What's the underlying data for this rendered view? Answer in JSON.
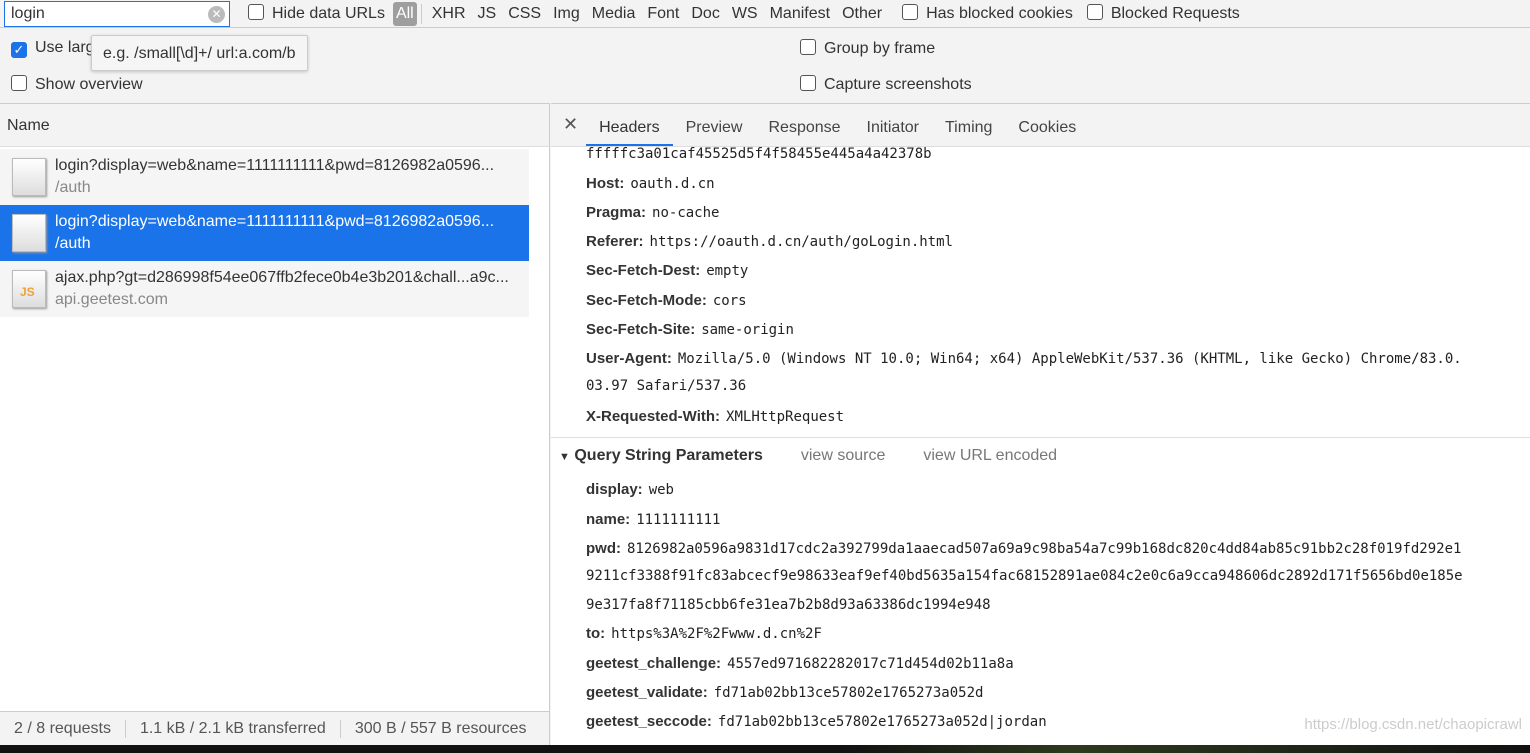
{
  "filter": {
    "search_value": "login",
    "hide_data_urls": "Hide data URLs",
    "types": [
      "All",
      "XHR",
      "JS",
      "CSS",
      "Img",
      "Media",
      "Font",
      "Doc",
      "WS",
      "Manifest",
      "Other"
    ],
    "has_blocked_cookies": "Has blocked cookies",
    "blocked_requests": "Blocked Requests"
  },
  "options": {
    "use_large": "Use larg",
    "show_overview": "Show overview",
    "group_by_frame": "Group by frame",
    "capture_screenshots": "Capture screenshots"
  },
  "tooltip": "e.g. /small[\\d]+/ url:a.com/b",
  "list": {
    "header": "Name",
    "rows": [
      {
        "name": "login?display=web&name=1111111111&pwd=8126982a0596...",
        "sub": "/auth",
        "type": "doc"
      },
      {
        "name": "login?display=web&name=1111111111&pwd=8126982a0596...",
        "sub": "/auth",
        "type": "doc",
        "selected": true
      },
      {
        "name": "ajax.php?gt=d286998f54ee067ffb2fece0b4e3b201&chall...a9c...",
        "sub": "api.geetest.com",
        "type": "js"
      }
    ]
  },
  "status": {
    "requests": "2 / 8 requests",
    "transferred": "1.1 kB / 2.1 kB transferred",
    "resources": "300 B / 557 B resources"
  },
  "tabs": [
    "Headers",
    "Preview",
    "Response",
    "Initiator",
    "Timing",
    "Cookies"
  ],
  "headers": [
    {
      "k": "",
      "v": "fffffc3a01caf45525d5f4f58455e445a4a42378b"
    },
    {
      "k": "Host:",
      "v": "oauth.d.cn"
    },
    {
      "k": "Pragma:",
      "v": "no-cache"
    },
    {
      "k": "Referer:",
      "v": "https://oauth.d.cn/auth/goLogin.html"
    },
    {
      "k": "Sec-Fetch-Dest:",
      "v": "empty"
    },
    {
      "k": "Sec-Fetch-Mode:",
      "v": "cors"
    },
    {
      "k": "Sec-Fetch-Site:",
      "v": "same-origin"
    },
    {
      "k": "User-Agent:",
      "v": "Mozilla/5.0 (Windows NT 10.0; Win64; x64) AppleWebKit/537.36 (KHTML, like Gecko) Chrome/83.0."
    },
    {
      "k": "",
      "v": "03.97 Safari/537.36"
    },
    {
      "k": "X-Requested-With:",
      "v": "XMLHttpRequest"
    }
  ],
  "query": {
    "title": "Query String Parameters",
    "view_source": "view source",
    "view_url_encoded": "view URL encoded",
    "params": [
      {
        "k": "display:",
        "v": "web"
      },
      {
        "k": "name:",
        "v": "1111111111"
      },
      {
        "k": "pwd:",
        "v": "8126982a0596a9831d17cdc2a392799da1aaecad507a69a9c98ba54a7c99b168dc820c4dd84ab85c91bb2c28f019fd292e1"
      },
      {
        "k": "",
        "v": "9211cf3388f91fc83abcecf9e98633eaf9ef40bd5635a154fac68152891ae084c2e0c6a9cca948606dc2892d171f5656bd0e185e"
      },
      {
        "k": "",
        "v": "9e317fa8f71185cbb6fe31ea7b2b8d93a63386dc1994e948"
      },
      {
        "k": "to:",
        "v": "https%3A%2F%2Fwww.d.cn%2F"
      },
      {
        "k": "geetest_challenge:",
        "v": "4557ed971682282017c71d454d02b11a8a"
      },
      {
        "k": "geetest_validate:",
        "v": "fd71ab02bb13ce57802e1765273a052d"
      },
      {
        "k": "geetest_seccode:",
        "v": "fd71ab02bb13ce57802e1765273a052d|jordan"
      }
    ]
  },
  "watermark": "https://blog.csdn.net/chaopicrawl",
  "colors": {
    "accent": "#1a73e8"
  }
}
